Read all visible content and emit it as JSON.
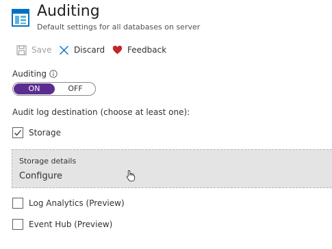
{
  "header": {
    "icon": "sql-server-blade-icon",
    "title": "Auditing",
    "subtitle": "Default settings for all databases on server"
  },
  "toolbar": {
    "save_label": "Save",
    "discard_label": "Discard",
    "feedback_label": "Feedback"
  },
  "auditing": {
    "label": "Auditing",
    "on_label": "ON",
    "off_label": "OFF",
    "selected": "ON"
  },
  "destination": {
    "label": "Audit log destination (choose at least one):",
    "storage": {
      "label": "Storage",
      "checked": true
    },
    "storage_details": {
      "title": "Storage details",
      "link": "Configure"
    },
    "log_analytics": {
      "label": "Log Analytics (Preview)",
      "checked": false
    },
    "event_hub": {
      "label": "Event Hub (Preview)",
      "checked": false
    }
  },
  "colors": {
    "toggle_on": "#5c2d91",
    "header_icon": "#0072c6",
    "feedback_heart": "#c1272d",
    "panel_background": "#e4e4e4"
  }
}
